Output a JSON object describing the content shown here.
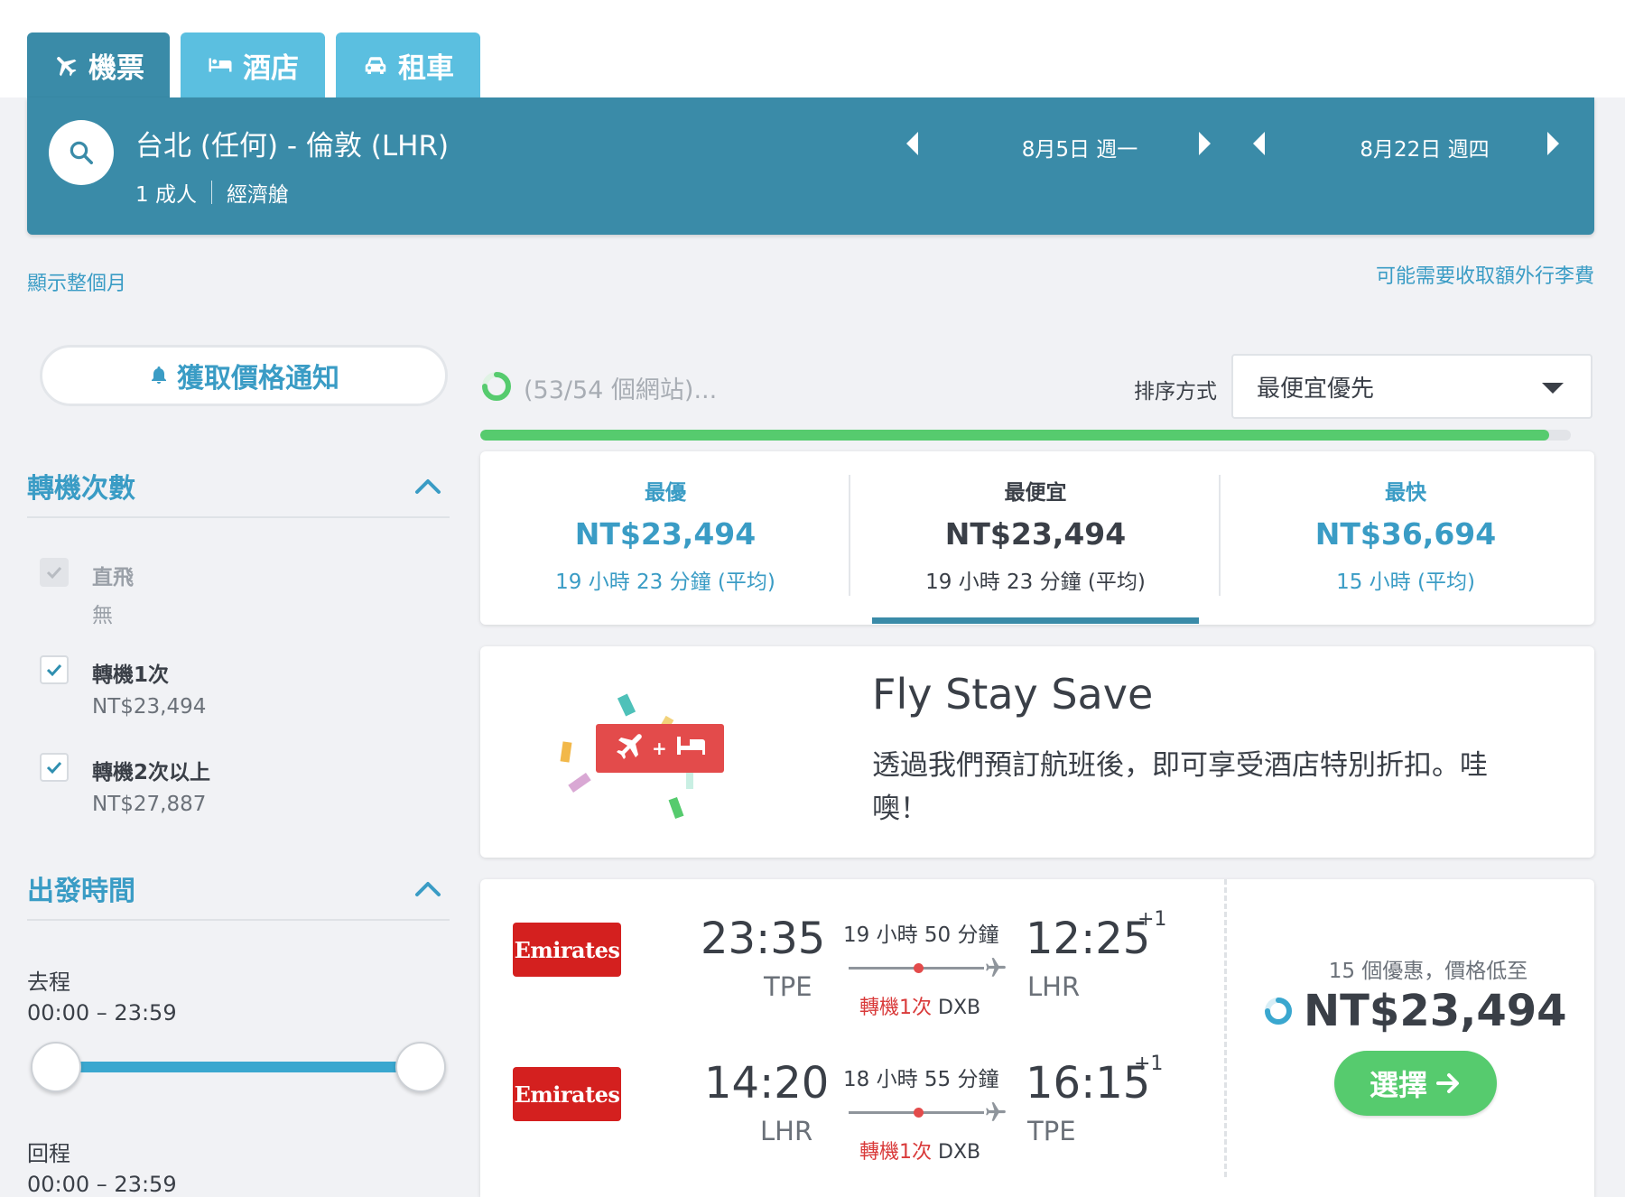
{
  "tabs": [
    {
      "label": "機票",
      "icon": "plane-icon",
      "active": true
    },
    {
      "label": "酒店",
      "icon": "bed-icon",
      "active": false
    },
    {
      "label": "租車",
      "icon": "car-icon",
      "active": false
    }
  ],
  "search": {
    "route": "台北 (任何) - 倫敦 (LHR)",
    "passengers": "1 成人",
    "cabin": "經濟艙",
    "depart_date": "8月5日 週一",
    "return_date": "8月22日 週四"
  },
  "links": {
    "show_month": "顯示整個月",
    "baggage_fee": "可能需要收取額外行李費"
  },
  "alert_button": "獲取價格通知",
  "filters": {
    "stops": {
      "title": "轉機次數",
      "options": [
        {
          "label": "直飛",
          "sub": "無",
          "checked": true,
          "disabled": true
        },
        {
          "label": "轉機1次",
          "sub": "NT$23,494",
          "checked": true,
          "disabled": false
        },
        {
          "label": "轉機2次以上",
          "sub": "NT$27,887",
          "checked": true,
          "disabled": false
        }
      ]
    },
    "departure": {
      "title": "出發時間",
      "outbound_label": "去程",
      "outbound_range": "00:00 – 23:59",
      "return_label": "回程",
      "return_range": "00:00 – 23:59"
    }
  },
  "progress": {
    "text": "(53/54 個網站)...",
    "fraction": 0.98
  },
  "sort": {
    "label": "排序方式",
    "selected": "最便宜優先"
  },
  "summary": [
    {
      "label": "最優",
      "price": "NT$23,494",
      "duration": "19 小時 23 分鐘 (平均)"
    },
    {
      "label": "最便宜",
      "price": "NT$23,494",
      "duration": "19 小時 23 分鐘 (平均)"
    },
    {
      "label": "最快",
      "price": "NT$36,694",
      "duration": "15 小時 (平均)"
    }
  ],
  "promo": {
    "title": "Fly Stay Save",
    "text": "透過我們預訂航班後，即可享受酒店特別折扣。哇噢！"
  },
  "result": {
    "legs": [
      {
        "airline": "Emirates",
        "dep_time": "23:35",
        "dep_code": "TPE",
        "duration": "19 小時 50 分鐘",
        "stops_label": "轉機1次",
        "stop_airport": "DXB",
        "arr_time": "12:25",
        "arr_code": "LHR",
        "day_offset": "+1"
      },
      {
        "airline": "Emirates",
        "dep_time": "14:20",
        "dep_code": "LHR",
        "duration": "18 小時 55 分鐘",
        "stops_label": "轉機1次",
        "stop_airport": "DXB",
        "arr_time": "16:15",
        "arr_code": "TPE",
        "day_offset": "+1"
      }
    ],
    "deals_text": "15 個優惠，價格低至",
    "price": "NT$23,494",
    "select_label": "選擇"
  },
  "colors": {
    "primary": "#3a8ba8",
    "accent": "#3a9cc5",
    "tab": "#5bbfe0",
    "green": "#56cb6e",
    "airline_red": "#d4201f",
    "stop_red": "#d93a3a"
  }
}
